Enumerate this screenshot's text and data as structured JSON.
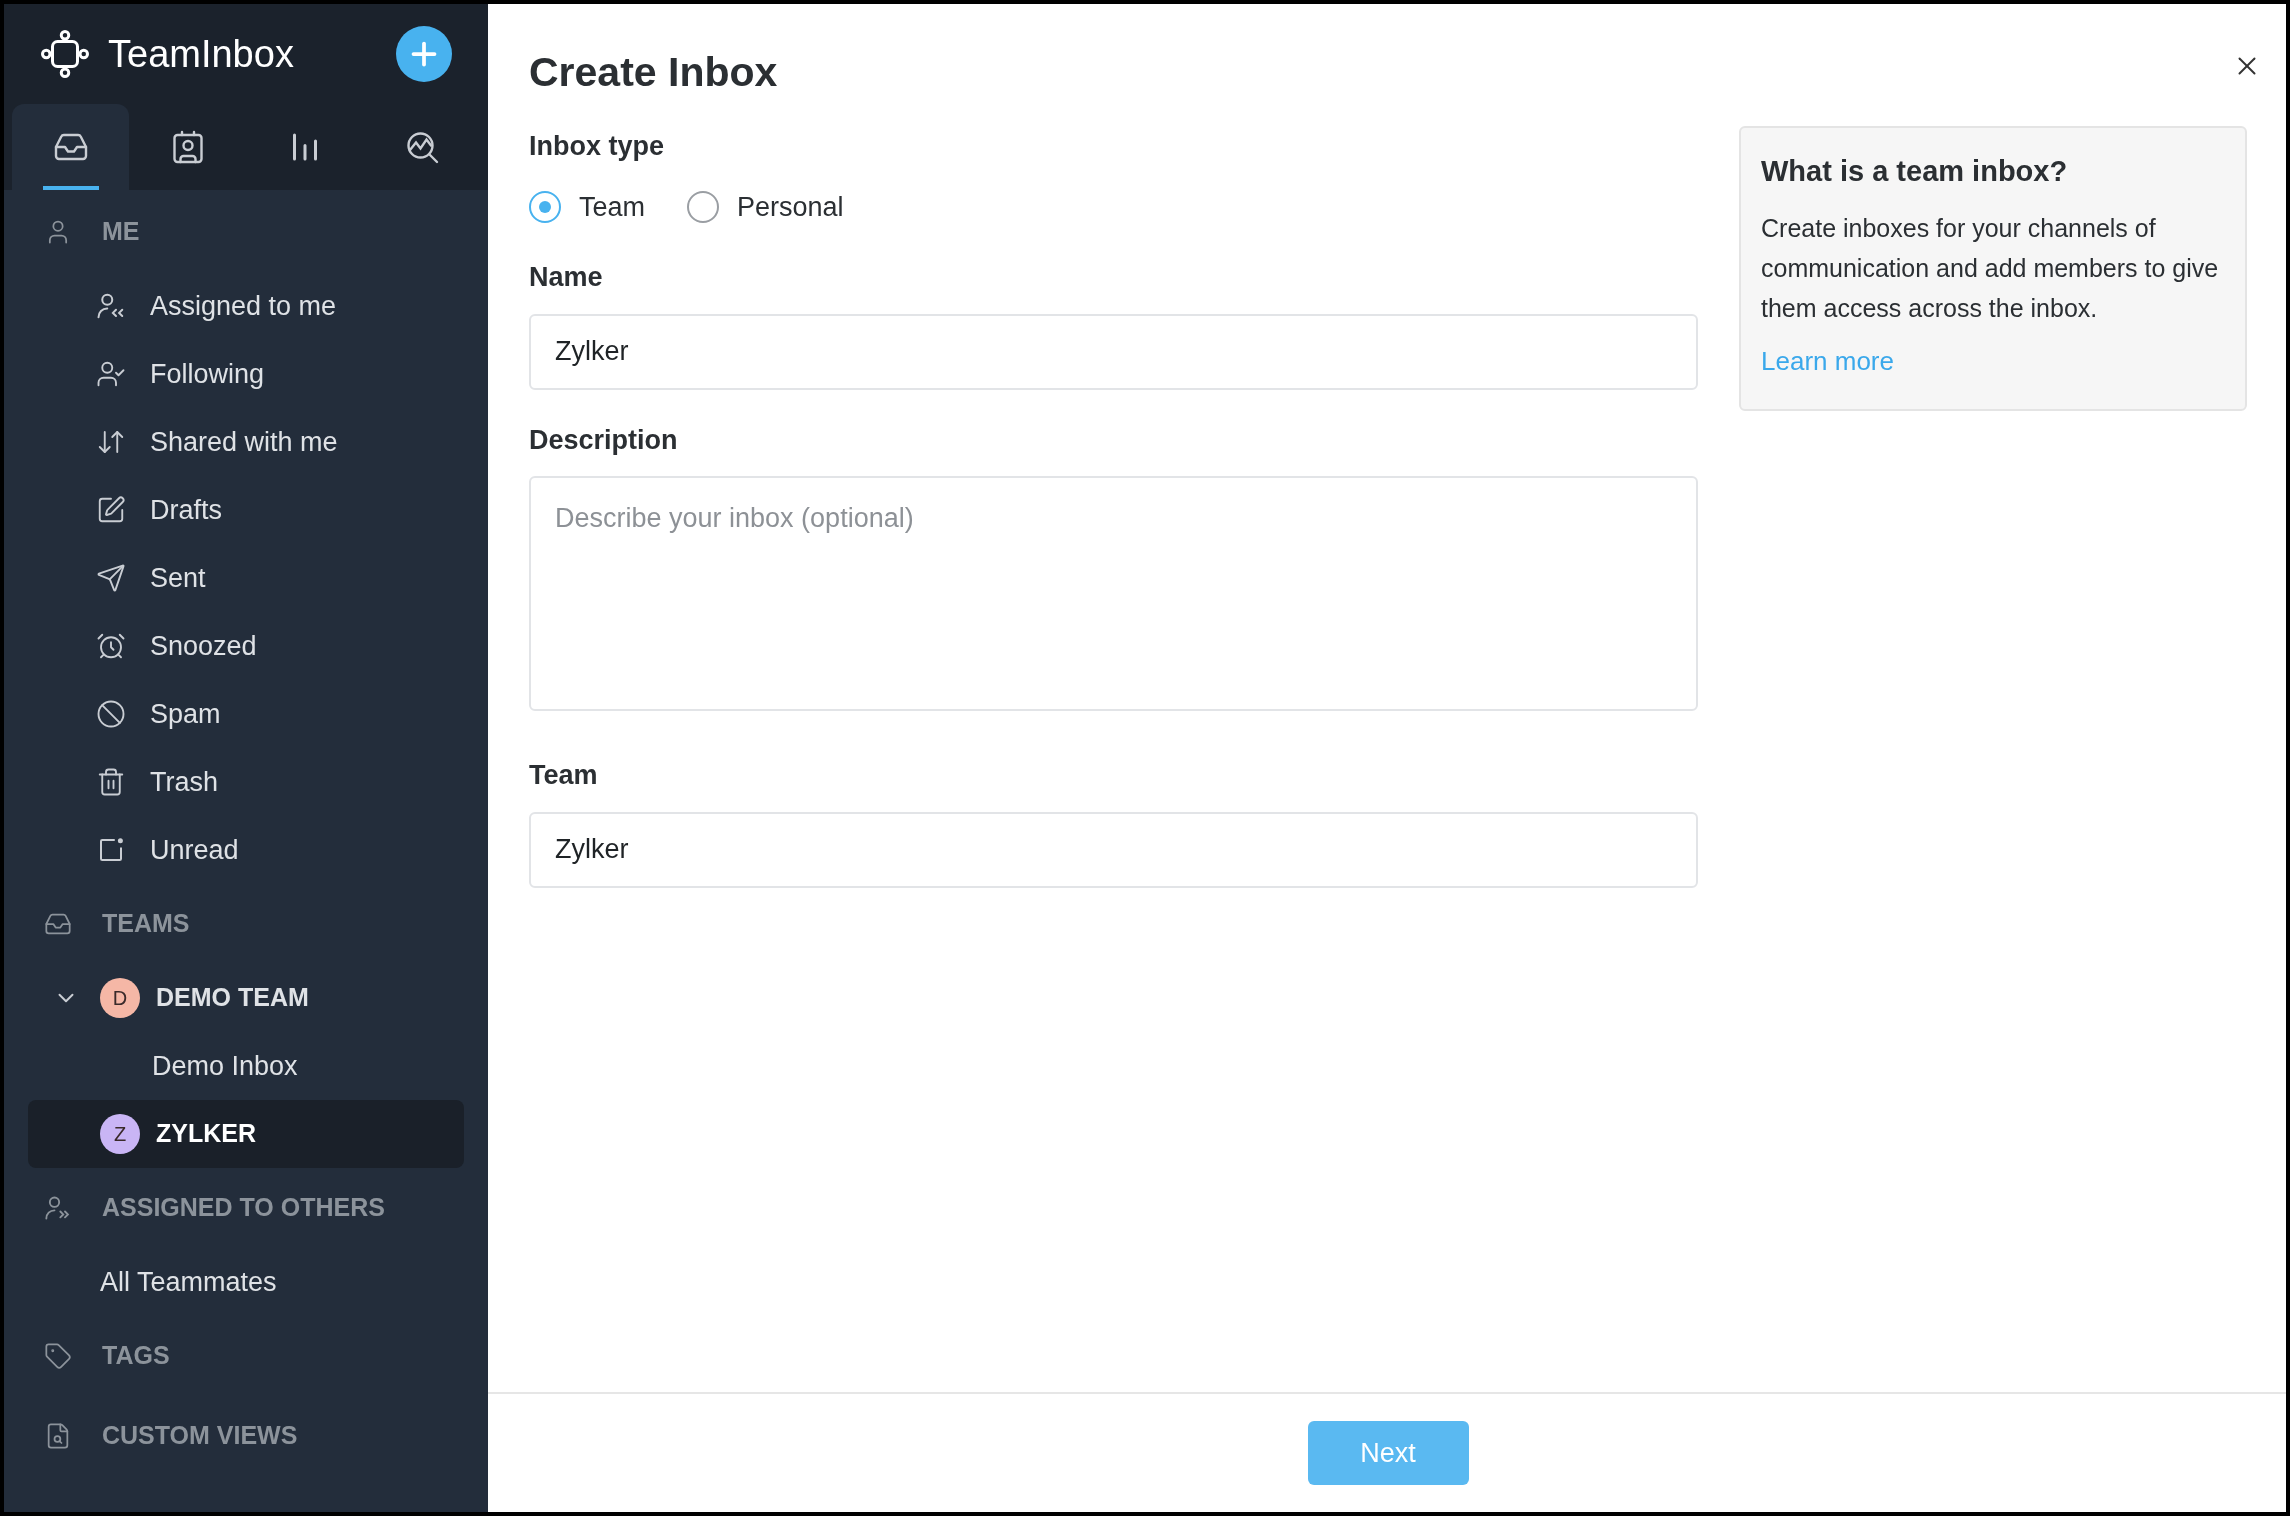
{
  "app": {
    "title": "TeamInbox"
  },
  "nav_tabs": [
    {
      "selected": true
    },
    {
      "selected": false
    },
    {
      "selected": false
    },
    {
      "selected": false
    }
  ],
  "sidebar": {
    "sections": [
      {
        "kind": "list",
        "heading": "ME",
        "items": [
          {
            "label": "Assigned to me",
            "selected": false
          },
          {
            "label": "Following",
            "selected": false
          },
          {
            "label": "Shared with me",
            "selected": false
          },
          {
            "label": "Drafts",
            "selected": false
          },
          {
            "label": "Sent",
            "selected": false
          },
          {
            "label": "Snoozed",
            "selected": false
          },
          {
            "label": "Spam",
            "selected": false
          },
          {
            "label": "Trash",
            "selected": false
          },
          {
            "label": "Unread",
            "selected": false
          }
        ]
      },
      {
        "kind": "teams",
        "heading": "TEAMS",
        "items": [
          {
            "label": "DEMO TEAM",
            "avatar": "D",
            "color": "#f5b7a6",
            "expanded": true,
            "selected": false,
            "children": [
              {
                "label": "Demo Inbox",
                "selected": false
              }
            ]
          },
          {
            "label": "ZYLKER",
            "avatar": "Z",
            "color": "#c9b5f5",
            "selected": true
          }
        ]
      },
      {
        "kind": "plain",
        "heading": "ASSIGNED TO OTHERS",
        "items": [
          {
            "label": "All Teammates",
            "selected": false
          }
        ]
      },
      {
        "kind": "heading",
        "heading": "TAGS"
      },
      {
        "kind": "heading",
        "heading": "CUSTOM VIEWS"
      }
    ]
  },
  "dialog": {
    "title": "Create Inbox",
    "inbox_type": {
      "label": "Inbox type",
      "options": [
        {
          "label": "Team",
          "selected": true
        },
        {
          "label": "Personal",
          "selected": false
        }
      ]
    },
    "fields": [
      {
        "kind": "input",
        "label": "Name",
        "value": "Zylker"
      },
      {
        "kind": "textarea",
        "label": "Description",
        "placeholder": "Describe your inbox (optional)"
      },
      {
        "kind": "input",
        "label": "Team",
        "value": "Zylker"
      }
    ],
    "info": {
      "title": "What is a team inbox?",
      "text": "Create inboxes for your channels of communication and add members to give them access across the inbox.",
      "link": "Learn more"
    },
    "next_button": "Next"
  }
}
